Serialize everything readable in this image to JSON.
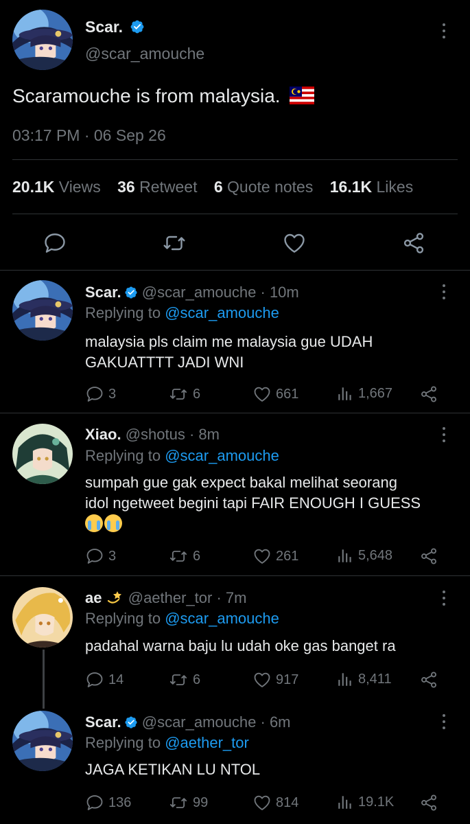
{
  "main_tweet": {
    "display_name": "Scar.",
    "handle": "@scar_amouche",
    "text": "Scaramouche is from malaysia.",
    "flag_emoji": "malaysia-flag",
    "timestamp": "03:17 PM · 06 Sep 26",
    "stats": {
      "views_num": "20.1K",
      "views_label": "Views",
      "retweets_num": "36",
      "retweets_label": "Retweet",
      "quotes_num": "6",
      "quotes_label": "Quote notes",
      "likes_num": "16.1K",
      "likes_label": "Likes"
    },
    "actions": [
      "reply-icon",
      "retweet-icon",
      "like-icon",
      "share-icon"
    ]
  },
  "replies": [
    {
      "display_name": "Scar.",
      "verified": true,
      "handle": "@scar_amouche",
      "time": "· 10m",
      "replying_prefix": "Replying to",
      "replying_to": "@scar_amouche",
      "text_line1": "malaysia pls claim me malaysia gue UDAH",
      "text_line2": "GAKUATTTT JADI WNI",
      "replies": "3",
      "retweets": "6",
      "likes": "661",
      "views": "1,667"
    },
    {
      "display_name": "Xiao.",
      "verified": false,
      "handle": "@shotus",
      "time": "· 8m",
      "replying_prefix": "Replying to",
      "replying_to": "@scar_amouche",
      "text_line1": "sumpah gue gak expect bakal melihat seorang",
      "text_line2": "idol ngetweet begini tapi FAIR ENOUGH I GUESS",
      "emoji": "loudly-crying-face ×2",
      "replies": "3",
      "retweets": "6",
      "likes": "261",
      "views": "5,648"
    },
    {
      "display_name": "ae",
      "name_emoji": "dizzy-emoji",
      "verified": false,
      "handle": "@aether_tor",
      "time": "· 7m",
      "replying_prefix": "Replying to",
      "replying_to": "@scar_amouche",
      "text_line1": "padahal warna baju lu udah oke gas banget ra",
      "replies": "14",
      "retweets": "6",
      "likes": "917",
      "views": "8,411"
    },
    {
      "display_name": "Scar.",
      "verified": true,
      "handle": "@scar_amouche",
      "time": "· 6m",
      "replying_prefix": "Replying to",
      "replying_to": "@aether_tor",
      "text_line1": "JAGA KETIKAN LU NTOL",
      "replies": "136",
      "retweets": "99",
      "likes": "814",
      "views": "19.1K"
    }
  ],
  "colors": {
    "background": "#000000",
    "text": "#e7e9ea",
    "muted": "#71767b",
    "link": "#1d9bf0",
    "verified": "#1d9bf0",
    "divider": "#2f3336"
  }
}
